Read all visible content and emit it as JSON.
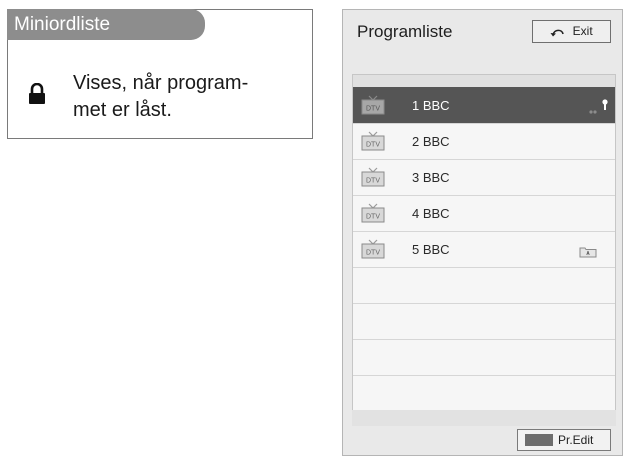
{
  "mini_list": {
    "header": "Miniordliste",
    "lock_icon": "lock-icon",
    "description_line1": "Vises, når program-",
    "description_line2": "met er låst."
  },
  "program_list": {
    "title": "Programliste",
    "exit_label": "Exit",
    "channels": [
      {
        "label": "1 BBC",
        "selected": true,
        "indicators": [
          "dots",
          "lock"
        ]
      },
      {
        "label": "2 BBC",
        "selected": false,
        "indicators": []
      },
      {
        "label": "3 BBC",
        "selected": false,
        "indicators": []
      },
      {
        "label": "4 BBC",
        "selected": false,
        "indicators": []
      },
      {
        "label": "5 BBC",
        "selected": false,
        "indicators": [
          "favorite"
        ]
      }
    ],
    "edit_label": "Pr.Edit",
    "colors": {
      "selected_row": "#555555",
      "edit_key": "#6d6d6d"
    }
  }
}
